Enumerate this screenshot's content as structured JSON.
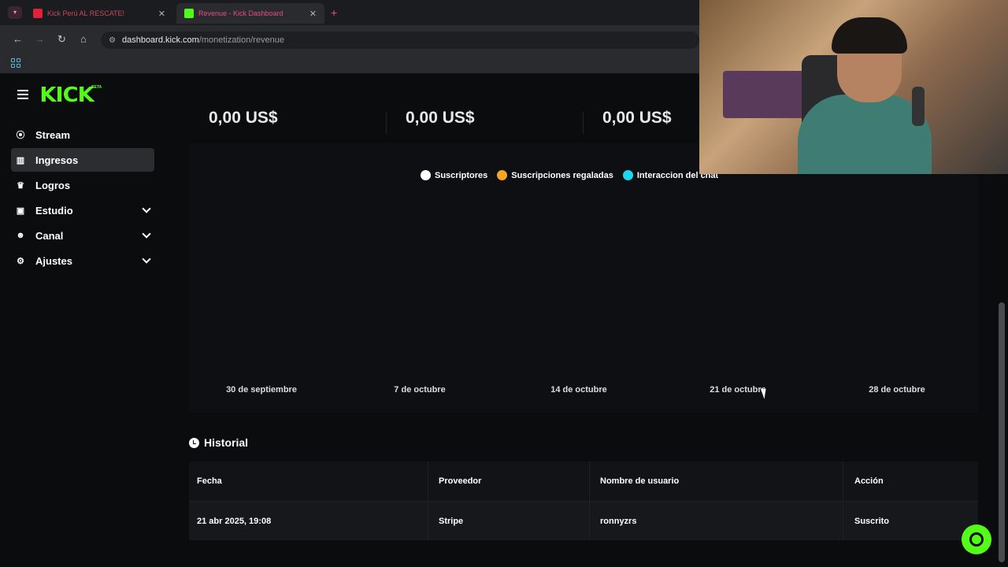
{
  "browser": {
    "tabs": [
      {
        "title": "Kick Perú AL RESCATE!",
        "active": false
      },
      {
        "title": "Revenue - Kick Dashboard",
        "active": true
      }
    ],
    "url_host": "dashboard.kick.com",
    "url_path": "/monetization/revenue"
  },
  "header": {
    "logo": "KICK",
    "logo_badge": "BETA"
  },
  "sidebar": {
    "items": [
      {
        "label": "Stream",
        "icon": "broadcast-icon",
        "expandable": false,
        "active": false
      },
      {
        "label": "Ingresos",
        "icon": "bar-chart-icon",
        "expandable": false,
        "active": true
      },
      {
        "label": "Logros",
        "icon": "trophy-icon",
        "expandable": false,
        "active": false
      },
      {
        "label": "Estudio",
        "icon": "studio-icon",
        "expandable": true,
        "active": false
      },
      {
        "label": "Canal",
        "icon": "users-icon",
        "expandable": true,
        "active": false
      },
      {
        "label": "Ajustes",
        "icon": "gear-icon",
        "expandable": true,
        "active": false
      }
    ]
  },
  "stats": [
    "0,00 US$",
    "0,00 US$",
    "0,00 US$"
  ],
  "chart_data": {
    "type": "line",
    "x": [
      "30 de septiembre",
      "7 de octubre",
      "14 de octubre",
      "21 de octubre",
      "28 de octubre"
    ],
    "series": [
      {
        "name": "Suscriptores",
        "color": "#ffffff",
        "values": []
      },
      {
        "name": "Suscripciones regaladas",
        "color": "#f5a623",
        "values": []
      },
      {
        "name": "Interaccion del chat",
        "color": "#1ad8f0",
        "values": []
      }
    ],
    "legend": "top-center"
  },
  "history": {
    "title": "Historial",
    "columns": [
      "Fecha",
      "Proveedor",
      "Nombre de usuario",
      "Acción"
    ],
    "rows": [
      [
        "21 abr 2025, 19:08",
        "Stripe",
        "ronnyzrs",
        "Suscrito"
      ]
    ]
  },
  "colors": {
    "brand": "#53fc18",
    "background": "#0b0c0e"
  }
}
